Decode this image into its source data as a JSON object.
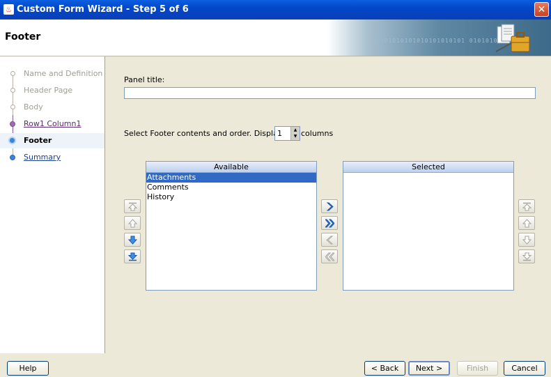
{
  "window": {
    "title": "Custom Form Wizard - Step 5 of 6",
    "close_glyph": "✕"
  },
  "header": {
    "step_heading": "Footer",
    "banner_text": "0101010101010101010101 01010101010"
  },
  "nav": {
    "items": [
      {
        "label": "Name and Definition",
        "state": "done"
      },
      {
        "label": "Header Page",
        "state": "done"
      },
      {
        "label": "Body",
        "state": "done"
      },
      {
        "label": "Row1 Column1",
        "state": "visited"
      },
      {
        "label": "Footer",
        "state": "current"
      },
      {
        "label": "Summary",
        "state": "future"
      }
    ]
  },
  "form": {
    "panel_title_label": "Panel title:",
    "panel_title_value": "",
    "select_label": "Select Footer contents and order.  Display in",
    "columns_value": "1",
    "columns_label": "columns"
  },
  "available": {
    "header": "Available",
    "items": [
      "Attachments",
      "Comments",
      "History"
    ],
    "selected_index": 0
  },
  "selected_list": {
    "header": "Selected",
    "items": []
  },
  "footer_buttons": {
    "help": "Help",
    "back": "< Back",
    "next": "Next >",
    "finish": "Finish",
    "cancel": "Cancel"
  },
  "colors": {
    "accent": "#316ac5",
    "title_bar": "#0347c9"
  }
}
